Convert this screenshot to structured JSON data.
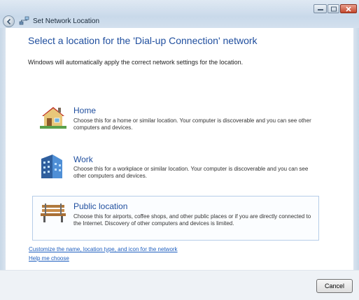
{
  "window": {
    "title": "Set Network Location"
  },
  "heading": "Select a location for the 'Dial-up Connection' network",
  "subtext": "Windows will automatically apply the correct network settings for the location.",
  "options": [
    {
      "title": "Home",
      "description": "Choose this for a home or similar location. Your computer is discoverable and you can see other computers and devices."
    },
    {
      "title": "Work",
      "description": "Choose this for a workplace or similar location. Your computer is discoverable and you can see other computers and devices."
    },
    {
      "title": "Public location",
      "description": "Choose this for airports, coffee shops, and other public places or if you are directly connected to the Internet. Discovery of other computers and devices is limited."
    }
  ],
  "links": {
    "customize": "Customize the name, location type, and icon for the network",
    "help": "Help me choose"
  },
  "footer": {
    "cancel": "Cancel"
  },
  "icons": {
    "back": "back-arrow-icon",
    "network": "network-icon",
    "home": "home-icon",
    "work": "office-building-icon",
    "public": "park-bench-icon"
  }
}
